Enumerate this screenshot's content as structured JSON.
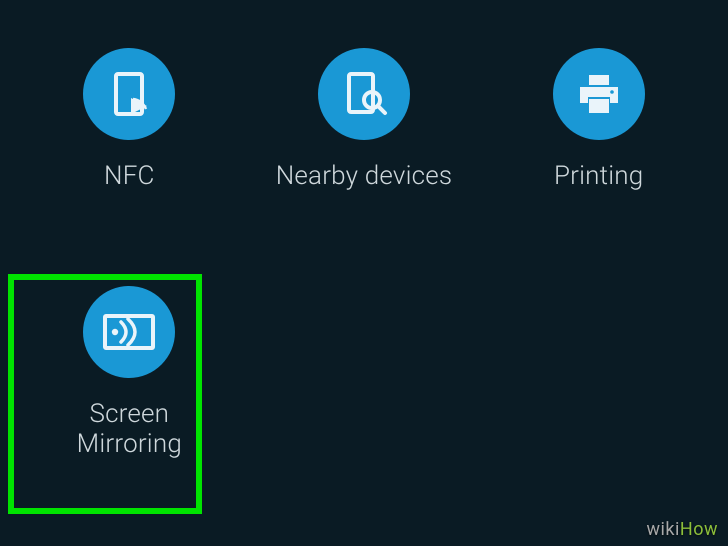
{
  "tiles": {
    "nfc": {
      "label": "NFC"
    },
    "nearby": {
      "label": "Nearby devices"
    },
    "printing": {
      "label": "Printing"
    },
    "mirror": {
      "label": "Screen\nMirroring"
    }
  },
  "watermark": {
    "wiki": "wiki",
    "how": "How"
  }
}
